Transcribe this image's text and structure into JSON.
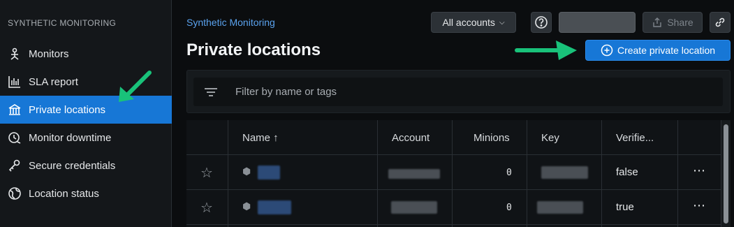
{
  "sidebar": {
    "heading": "SYNTHETIC MONITORING",
    "items": [
      {
        "label": "Monitors",
        "icon": "monitor-icon"
      },
      {
        "label": "SLA report",
        "icon": "bar-chart-icon"
      },
      {
        "label": "Private locations",
        "icon": "building-icon",
        "active": true
      },
      {
        "label": "Monitor downtime",
        "icon": "clock-icon"
      },
      {
        "label": "Secure credentials",
        "icon": "key-icon"
      },
      {
        "label": "Location status",
        "icon": "globe-icon"
      }
    ]
  },
  "header": {
    "breadcrumb": "Synthetic Monitoring",
    "title": "Private locations",
    "accounts_label": "All accounts",
    "share_label": "Share",
    "create_label": "Create private location"
  },
  "filter": {
    "placeholder": "Filter by name or tags"
  },
  "table": {
    "columns": [
      "Name ↑",
      "Account",
      "Minions",
      "Key",
      "Verifie..."
    ],
    "rows": [
      {
        "minions": "0",
        "verified": "false"
      },
      {
        "minions": "0",
        "verified": "true"
      }
    ]
  },
  "colors": {
    "accent": "#1777d6",
    "annotation_arrow": "#19c27a",
    "background": "#0b0d0f",
    "sidebar_bg": "#14171a"
  }
}
